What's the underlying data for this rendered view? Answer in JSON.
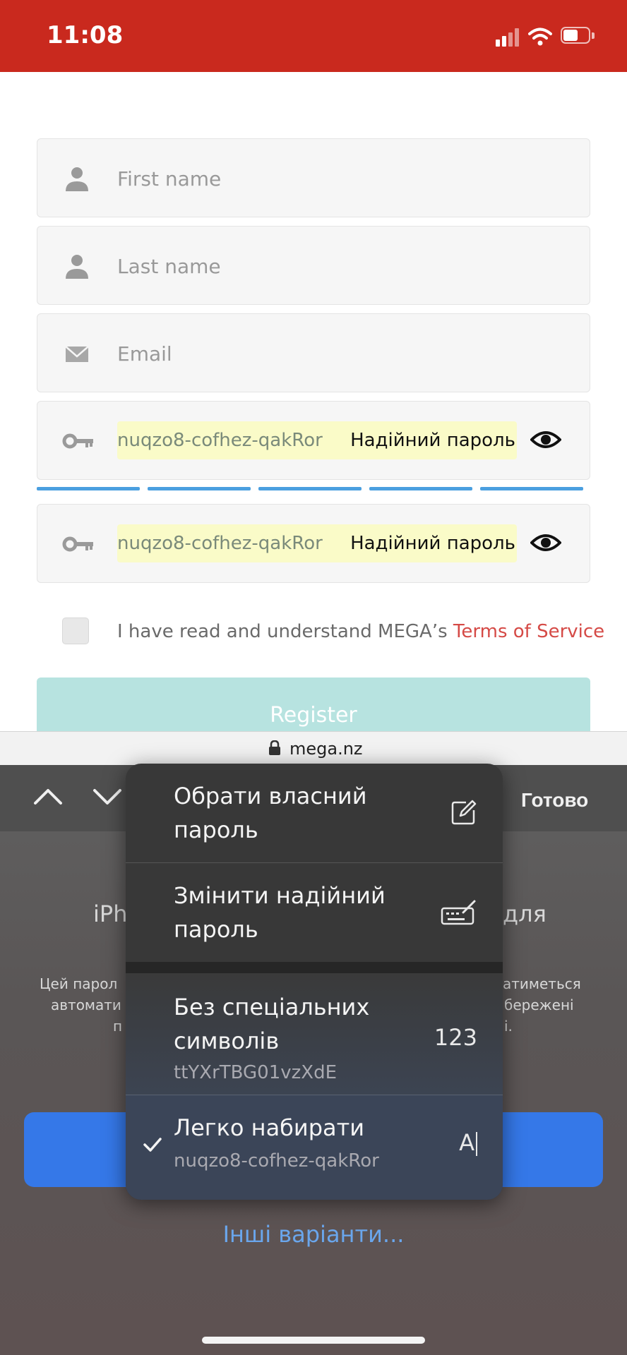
{
  "status_bar": {
    "time": "11:08"
  },
  "form": {
    "first_name_placeholder": "First name",
    "last_name_placeholder": "Last name",
    "email_placeholder": "Email",
    "password_value": "nuqzo8-cofhez-qakRor",
    "password_strength_label": "Надійний пароль",
    "confirm_password_value": "nuqzo8-cofhez-qakRor",
    "confirm_strength_label": "Надійний пароль",
    "terms_prefix": "I have read and understand MEGA’s ",
    "terms_link": "Terms of Service",
    "register_label": "Register"
  },
  "url_bar": {
    "domain": "mega.nz"
  },
  "keyboard_toolbar": {
    "done_label": "Готово"
  },
  "background": {
    "line1_left": "iPh",
    "line1_right": "для",
    "info_left_1": "Цей парол",
    "info_left_2": "автомати",
    "info_left_3": "п",
    "info_right_1": "атиметься",
    "info_right_2": "бережені",
    "info_right_3": "і.",
    "other_options": "Інші варіанти..."
  },
  "menu": {
    "choose_own_line1": "Обрати власний",
    "choose_own_line2": "пароль",
    "change_strong_line1": "Змінити надійний",
    "change_strong_line2": "пароль",
    "no_special_line1": "Без спеціальних",
    "no_special_line2": "символів",
    "no_special_password": "ttYXrTBG01vzXdE",
    "no_special_badge": "123",
    "easy_type_title": "Легко набирати",
    "easy_type_password": "nuqzo8-cofhez-qakRor",
    "easy_type_badge": "A"
  },
  "colors": {
    "status_bar_bg": "#c9291e",
    "terms_link": "#d54a46",
    "register_bg": "#b7e3e0",
    "strength_bar": "#4a9fe0",
    "autofill_bg": "#fafbc8",
    "primary_blue": "#3578e8"
  }
}
